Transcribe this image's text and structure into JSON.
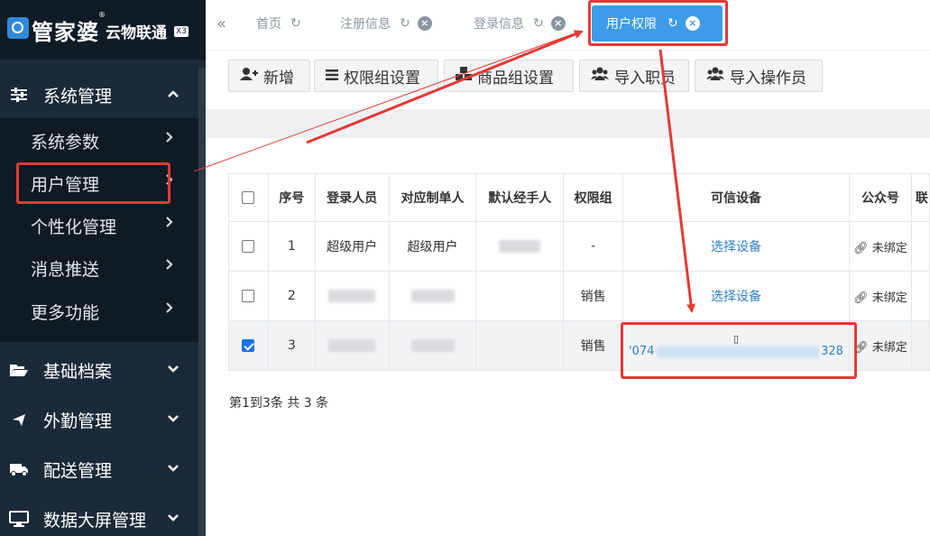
{
  "app": {
    "logo_main": "管家婆",
    "logo_sub": "云物联通",
    "logo_badge": "X3",
    "logo_reg": "®"
  },
  "sidebar": {
    "groups": [
      {
        "label": "系统管理",
        "icon": "sliders-icon",
        "expanded": true
      },
      {
        "label": "基础档案",
        "icon": "folder-open-icon",
        "expanded": false
      },
      {
        "label": "外勤管理",
        "icon": "plane-icon",
        "expanded": false
      },
      {
        "label": "配送管理",
        "icon": "truck-icon",
        "expanded": false
      },
      {
        "label": "数据大屏管理",
        "icon": "monitor-icon",
        "expanded": false
      }
    ],
    "sub_items": [
      {
        "label": "系统参数"
      },
      {
        "label": "用户管理",
        "highlighted": true
      },
      {
        "label": "个性化管理"
      },
      {
        "label": "消息推送"
      },
      {
        "label": "更多功能"
      }
    ]
  },
  "tabs": {
    "collapse_glyph": "«",
    "items": [
      {
        "label": "首页",
        "closable": false
      },
      {
        "label": "注册信息",
        "closable": true
      },
      {
        "label": "登录信息",
        "closable": true
      },
      {
        "label": "用户权限",
        "closable": true,
        "active": true
      }
    ]
  },
  "toolbar": {
    "buttons": [
      {
        "label": "新增",
        "icon": "user-plus-icon"
      },
      {
        "label": "权限组设置",
        "icon": "list-icon"
      },
      {
        "label": "商品组设置",
        "icon": "cubes-icon"
      },
      {
        "label": "导入职员",
        "icon": "users-icon"
      },
      {
        "label": "导入操作员",
        "icon": "users-icon"
      }
    ]
  },
  "table": {
    "headers": [
      "序号",
      "登录人员",
      "对应制单人",
      "默认经手人",
      "权限组",
      "可信设备",
      "公众号",
      "联"
    ],
    "rows": [
      {
        "checked": false,
        "index": "1",
        "login_user": "超级用户",
        "owner": "超级用户",
        "handler": "",
        "group": "-",
        "device": "选择设备",
        "wechat": "未绑定"
      },
      {
        "checked": false,
        "index": "2",
        "login_user": "",
        "owner": "",
        "handler": "",
        "group": "销售",
        "device": "选择设备",
        "wechat": "未绑定"
      },
      {
        "checked": true,
        "index": "3",
        "login_user": "",
        "owner": "",
        "handler": "",
        "group": "销售",
        "device_prefix": "'074",
        "device_suffix": "328",
        "wechat": "未绑定"
      }
    ]
  },
  "pager": {
    "text": "第1到3条 共 3 条"
  },
  "colors": {
    "sidebar_bg": "#1b2a38",
    "active_tab": "#3d9be9",
    "annotation_red": "#e53935",
    "link_blue": "#2f7fc9"
  }
}
